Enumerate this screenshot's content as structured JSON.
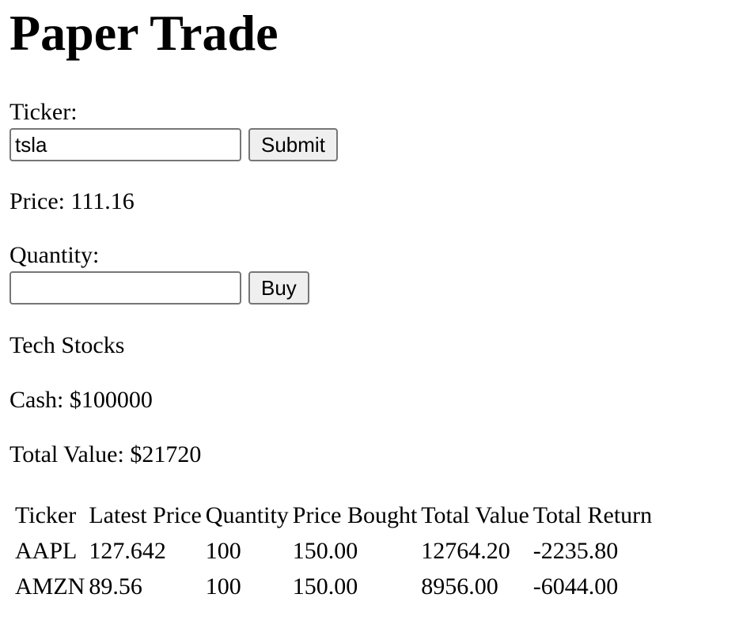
{
  "page": {
    "title": "Paper Trade"
  },
  "ticker_form": {
    "label": "Ticker:",
    "value": "tsla",
    "submit_label": "Submit"
  },
  "price": {
    "text": "Price: 111.16"
  },
  "quantity_form": {
    "label": "Quantity:",
    "value": "",
    "buy_label": "Buy"
  },
  "portfolio": {
    "name": "Tech Stocks",
    "cash_text": "Cash: $100000",
    "total_value_text": "Total Value: $21720"
  },
  "holdings_table": {
    "headers": [
      "Ticker",
      "Latest Price",
      "Quantity",
      "Price Bought",
      "Total Value",
      "Total Return"
    ],
    "rows": [
      [
        "AAPL",
        "127.642",
        "100",
        "150.00",
        "12764.20",
        "-2235.80"
      ],
      [
        "AMZN",
        "89.56",
        "100",
        "150.00",
        "8956.00",
        "-6044.00"
      ]
    ]
  }
}
